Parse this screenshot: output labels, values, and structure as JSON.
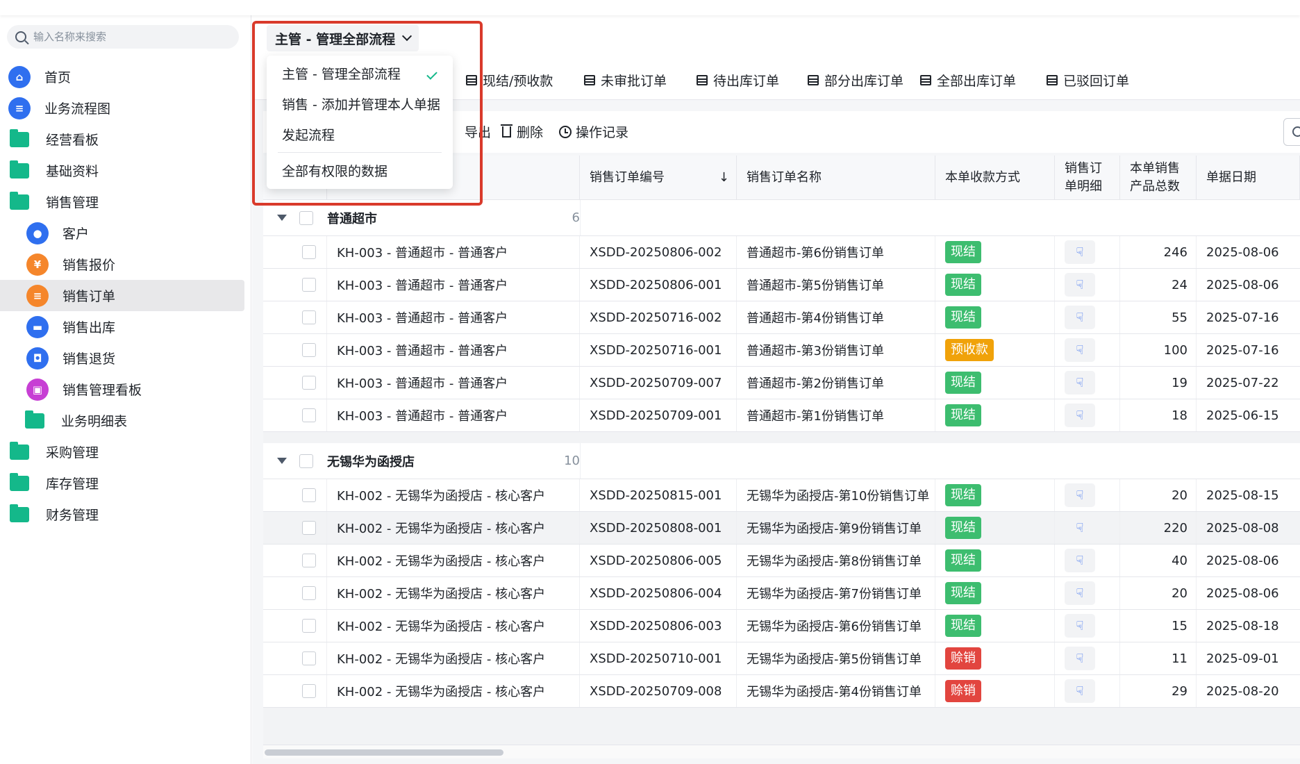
{
  "search": {
    "placeholder": "输入名称来搜索"
  },
  "sidebar": {
    "items": [
      {
        "label": "首页",
        "icon": "home-icon",
        "type": "top",
        "color": "#2f6fef"
      },
      {
        "label": "业务流程图",
        "icon": "document-icon",
        "type": "top",
        "color": "#2f6fef"
      },
      {
        "label": "经营看板",
        "icon": "folder-icon",
        "type": "folder"
      },
      {
        "label": "基础资料",
        "icon": "folder-icon",
        "type": "folder"
      },
      {
        "label": "销售管理",
        "icon": "folder-icon",
        "type": "folder"
      },
      {
        "label": "客户",
        "icon": "user-icon",
        "type": "sub",
        "color": "#2f6fef"
      },
      {
        "label": "销售报价",
        "icon": "price-tag-icon",
        "type": "sub",
        "color": "#f5862b"
      },
      {
        "label": "销售订单",
        "icon": "order-icon",
        "type": "sub",
        "color": "#f5862b",
        "active": true
      },
      {
        "label": "销售出库",
        "icon": "truck-icon",
        "type": "sub",
        "color": "#2f6fef"
      },
      {
        "label": "销售退货",
        "icon": "return-bag-icon",
        "type": "sub",
        "color": "#2f6fef"
      },
      {
        "label": "销售管理看板",
        "icon": "dashboard-icon",
        "type": "sub",
        "color": "#c73fd4"
      },
      {
        "label": "业务明细表",
        "icon": "folder-icon",
        "type": "subfolder"
      },
      {
        "label": "采购管理",
        "icon": "folder-icon",
        "type": "folder"
      },
      {
        "label": "库存管理",
        "icon": "folder-icon",
        "type": "folder"
      },
      {
        "label": "财务管理",
        "icon": "folder-icon",
        "type": "folder"
      }
    ]
  },
  "dropdown": {
    "selected": "主管 - 管理全部流程",
    "options": [
      "主管 - 管理全部流程",
      "销售 - 添加并管理本人单据",
      "发起流程",
      "全部有权限的数据"
    ]
  },
  "tabs": [
    "现结/预收款",
    "未审批订单",
    "待出库订单",
    "部分出库订单",
    "全部出库订单",
    "已驳回订单"
  ],
  "toolbar": {
    "export": "导出",
    "delete": "删除",
    "log": "操作记录"
  },
  "table": {
    "headers": [
      "销售订单编号",
      "销售订单名称",
      "本单收款方式",
      "销售订\n单明细",
      "本单销售\n产品总数",
      "单据日期"
    ],
    "sort_indicator": "↓",
    "groups": [
      {
        "name": "普通超市",
        "count": "6",
        "rows": [
          {
            "customer": "KH-003 -  普通超市 - 普通客户",
            "code": "XSDD-20250806-002",
            "name": "普通超市-第6份销售订单",
            "payment": "现结",
            "total": "246",
            "date": "2025-08-06"
          },
          {
            "customer": "KH-003 -  普通超市 - 普通客户",
            "code": "XSDD-20250806-001",
            "name": "普通超市-第5份销售订单",
            "payment": "现结",
            "total": "24",
            "date": "2025-08-06"
          },
          {
            "customer": "KH-003 -  普通超市 - 普通客户",
            "code": "XSDD-20250716-002",
            "name": "普通超市-第4份销售订单",
            "payment": "现结",
            "total": "55",
            "date": "2025-07-16"
          },
          {
            "customer": "KH-003 -  普通超市 - 普通客户",
            "code": "XSDD-20250716-001",
            "name": "普通超市-第3份销售订单",
            "payment": "预收款",
            "total": "100",
            "date": "2025-07-16"
          },
          {
            "customer": "KH-003 -  普通超市 - 普通客户",
            "code": "XSDD-20250709-007",
            "name": "普通超市-第2份销售订单",
            "payment": "现结",
            "total": "19",
            "date": "2025-07-22"
          },
          {
            "customer": "KH-003 -  普通超市 - 普通客户",
            "code": "XSDD-20250709-001",
            "name": "普通超市-第1份销售订单",
            "payment": "现结",
            "total": "18",
            "date": "2025-06-15"
          }
        ]
      },
      {
        "name": "无锡华为函授店",
        "count": "10",
        "rows": [
          {
            "customer": "KH-002 -  无锡华为函授店 - 核心客户",
            "code": "XSDD-20250815-001",
            "name": "无锡华为函授店-第10份销售订单",
            "payment": "现结",
            "total": "20",
            "date": "2025-08-15"
          },
          {
            "customer": "KH-002 -  无锡华为函授店 - 核心客户",
            "code": "XSDD-20250808-001",
            "name": "无锡华为函授店-第9份销售订单",
            "payment": "现结",
            "total": "220",
            "date": "2025-08-08"
          },
          {
            "customer": "KH-002 -  无锡华为函授店 - 核心客户",
            "code": "XSDD-20250806-005",
            "name": "无锡华为函授店-第8份销售订单",
            "payment": "现结",
            "total": "40",
            "date": "2025-08-06"
          },
          {
            "customer": "KH-002 -  无锡华为函授店 - 核心客户",
            "code": "XSDD-20250806-004",
            "name": "无锡华为函授店-第7份销售订单",
            "payment": "现结",
            "total": "20",
            "date": "2025-08-06"
          },
          {
            "customer": "KH-002 -  无锡华为函授店 - 核心客户",
            "code": "XSDD-20250806-003",
            "name": "无锡华为函授店-第6份销售订单",
            "payment": "现结",
            "total": "15",
            "date": "2025-08-18"
          },
          {
            "customer": "KH-002 -  无锡华为函授店 - 核心客户",
            "code": "XSDD-20250710-001",
            "name": "无锡华为函授店-第5份销售订单",
            "payment": "赊销",
            "total": "11",
            "date": "2025-09-01"
          },
          {
            "customer": "KH-002 -  无锡华为函授店 - 核心客户",
            "code": "XSDD-20250709-008",
            "name": "无锡华为函授店-第4份销售订单",
            "payment": "赊销",
            "total": "29",
            "date": "2025-08-20"
          }
        ]
      }
    ]
  },
  "colors": {
    "cash": "#3dbd6f",
    "prepaid": "#f0a20a",
    "credit": "#e2453f",
    "accent": "#2f6fef",
    "highlight": "#d93a2b"
  }
}
